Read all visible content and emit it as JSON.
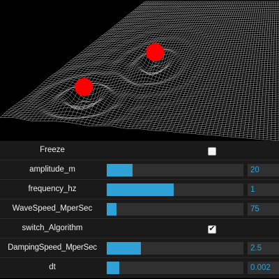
{
  "scene": {
    "sources": [
      {
        "name": "source-1",
        "color": "#ff0000"
      },
      {
        "name": "source-2",
        "color": "#ff0000"
      }
    ],
    "mesh_color": "#b0b0b0",
    "background": "#000000"
  },
  "controls": [
    {
      "id": "freeze",
      "type": "checkbox",
      "label": "Freeze",
      "checked": false
    },
    {
      "id": "amplitude",
      "type": "slider",
      "label": "amplitude_m",
      "value": "20",
      "fraction": 0.19
    },
    {
      "id": "frequency",
      "type": "slider",
      "label": "frequency_hz",
      "value": "1",
      "fraction": 0.49
    },
    {
      "id": "wavespeed",
      "type": "slider",
      "label": "WaveSpeed_MperSec",
      "value": "75",
      "fraction": 0.07
    },
    {
      "id": "switch-algorithm",
      "type": "checkbox",
      "label": "switch_Algorithm",
      "checked": true
    },
    {
      "id": "dampingspeed",
      "type": "slider",
      "label": "DampingSpeed_MperSec",
      "value": "2.5",
      "fraction": 0.25
    },
    {
      "id": "dt",
      "type": "slider",
      "label": "dt",
      "value": "0.002",
      "fraction": 0.09
    }
  ],
  "colors": {
    "accent": "#2fa1d6",
    "row_bg": "#1a1a1a",
    "track_bg": "#303030"
  }
}
